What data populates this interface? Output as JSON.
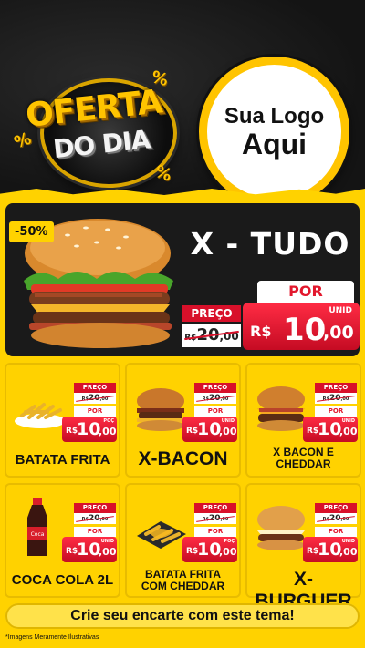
{
  "header": {
    "badge_line1": "OFERTA",
    "badge_line2": "DO DIA",
    "percent_symbol": "%",
    "logo_line1": "Sua Logo",
    "logo_line2": "Aqui"
  },
  "colors": {
    "brand_yellow": "#ffd200",
    "price_red": "#d8102a",
    "background_dark": "#1b1b1b"
  },
  "hero": {
    "discount": "-50%",
    "name": "X - TUDO",
    "preco_label": "PREÇO",
    "old_currency": "R$",
    "old_value": "20",
    "old_cents": ",00",
    "por_label": "POR",
    "unid_label": "UNID",
    "new_currency": "R$",
    "new_value": "10",
    "new_cents": ",00",
    "image_icon": "burger-icon"
  },
  "products": [
    {
      "name_line1": "BATATA FRITA",
      "name_line2": "",
      "preco_label": "PREÇO",
      "old_currency": "R$",
      "old_value": "20",
      "old_cents": ",00",
      "por_label": "POR",
      "unit_label": "POÇ",
      "new_currency": "R$",
      "new_value": "10",
      "new_cents": ",00",
      "image_icon": "fries-icon"
    },
    {
      "name_line1": "X-BACON",
      "name_line2": "",
      "preco_label": "PREÇO",
      "old_currency": "R$",
      "old_value": "20",
      "old_cents": ",00",
      "por_label": "POR",
      "unit_label": "UNID",
      "new_currency": "R$",
      "new_value": "10",
      "new_cents": ",00",
      "image_icon": "bacon-burger-icon"
    },
    {
      "name_line1": "X BACON E",
      "name_line2": "CHEDDAR",
      "preco_label": "PREÇO",
      "old_currency": "R$",
      "old_value": "20",
      "old_cents": ",00",
      "por_label": "POR",
      "unit_label": "UNID",
      "new_currency": "R$",
      "new_value": "10",
      "new_cents": ",00",
      "image_icon": "cheddar-burger-icon"
    },
    {
      "name_line1": "COCA COLA 2L",
      "name_line2": "",
      "preco_label": "PREÇO",
      "old_currency": "R$",
      "old_value": "20",
      "old_cents": ",00",
      "por_label": "POR",
      "unit_label": "UNID",
      "new_currency": "R$",
      "new_value": "10",
      "new_cents": ",00",
      "image_icon": "soda-bottle-icon"
    },
    {
      "name_line1": "BATATA FRITA",
      "name_line2": "COM CHEDDAR",
      "preco_label": "PREÇO",
      "old_currency": "R$",
      "old_value": "20",
      "old_cents": ",00",
      "por_label": "POR",
      "unit_label": "POÇ",
      "new_currency": "R$",
      "new_value": "10",
      "new_cents": ",00",
      "image_icon": "cheese-fries-icon"
    },
    {
      "name_line1": "X-BURGUER",
      "name_line2": "",
      "preco_label": "PREÇO",
      "old_currency": "R$",
      "old_value": "20",
      "old_cents": ",00",
      "por_label": "POR",
      "unit_label": "UNID",
      "new_currency": "R$",
      "new_value": "10",
      "new_cents": ",00",
      "image_icon": "cheeseburger-icon"
    }
  ],
  "footer": {
    "cta": "Crie seu encarte com este tema!",
    "disclaimer": "*Imagens Meramente Ilustrativas"
  }
}
